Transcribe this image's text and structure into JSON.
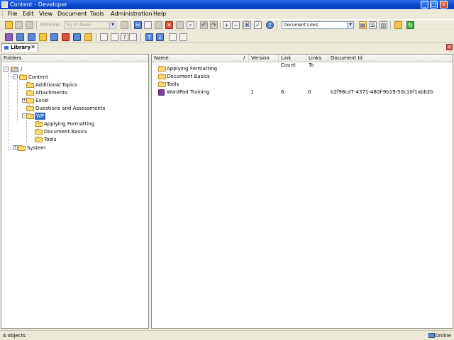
{
  "window": {
    "title": "Content - Developer"
  },
  "menu": {
    "items": [
      "File",
      "Edit",
      "View",
      "Document",
      "Tools",
      "Administration",
      "Help"
    ]
  },
  "toolbar": {
    "preview_label": "Preview",
    "mode_combo": "Try It! Mode",
    "view_combo": "Document Links"
  },
  "tabs": {
    "library_label": "Library"
  },
  "folders_panel": {
    "header": "Folders",
    "root_label": "/",
    "tree": [
      {
        "label": "Content",
        "level": 1,
        "expanded": true
      },
      {
        "label": "Additional Topics",
        "level": 2
      },
      {
        "label": "Attachments",
        "level": 2
      },
      {
        "label": "Excel",
        "level": 2,
        "expandable": true
      },
      {
        "label": "Questions and Assessments",
        "level": 2
      },
      {
        "label": "WP",
        "level": 2,
        "expanded": true,
        "selected": true
      },
      {
        "label": "Applying Formatting",
        "level": 3
      },
      {
        "label": "Document Basics",
        "level": 3
      },
      {
        "label": "Tools",
        "level": 3
      },
      {
        "label": "System",
        "level": 1,
        "expandable": true
      }
    ]
  },
  "list_panel": {
    "columns": [
      "Name",
      "/",
      "Version",
      "Link Count",
      "Links To",
      "Document Id"
    ],
    "rows": [
      {
        "type": "folder",
        "name": "Applying Formatting",
        "version": "",
        "link_count": "",
        "links_to": "",
        "document_id": ""
      },
      {
        "type": "folder",
        "name": "Document Basics",
        "version": "",
        "link_count": "",
        "links_to": "",
        "document_id": ""
      },
      {
        "type": "folder",
        "name": "Tools",
        "version": "",
        "link_count": "",
        "links_to": "",
        "document_id": ""
      },
      {
        "type": "document",
        "name": "WordPad Training",
        "version": "1",
        "link_count": "6",
        "links_to": "0",
        "document_id": "b2f98cd7-4371-480f-9b19-50c10f1abb2b"
      }
    ]
  },
  "status": {
    "objects": "4 objects",
    "connection": "Online"
  }
}
